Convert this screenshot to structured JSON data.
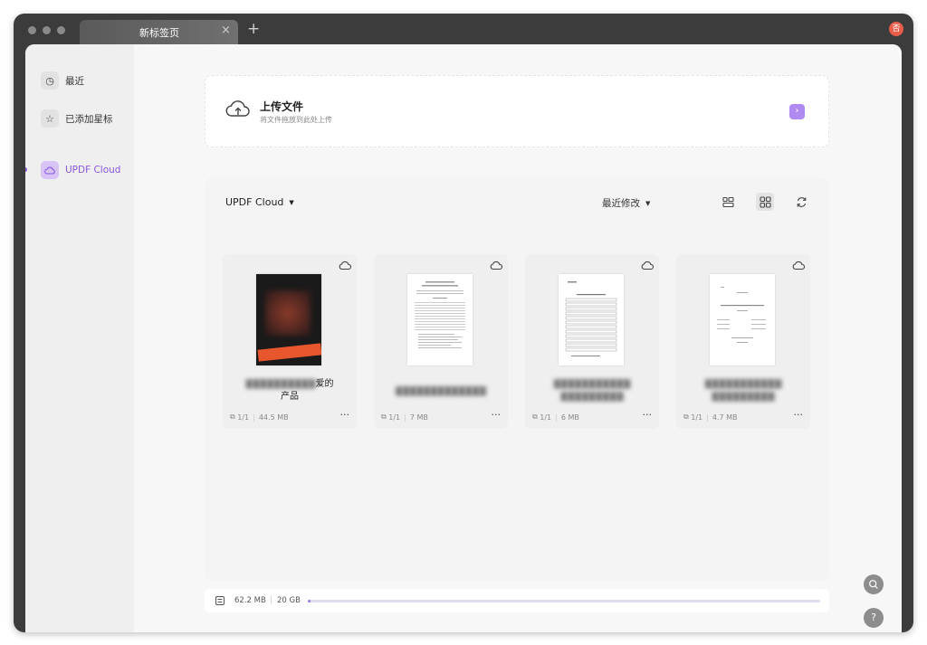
{
  "window": {
    "tab_title": "新标签页",
    "tab_close": "×",
    "new_tab": "+",
    "avatar_initial": "否"
  },
  "sidebar": {
    "items": [
      {
        "label": "最近",
        "icon": "clock-icon",
        "glyph": "◷"
      },
      {
        "label": "已添加星标",
        "icon": "star-icon",
        "glyph": "☆"
      },
      {
        "label": "UPDF Cloud",
        "icon": "cloud-icon",
        "glyph": "☁",
        "active": true
      }
    ]
  },
  "upload": {
    "title": "上传文件",
    "subtitle": "将文件拖放到此处上传",
    "button_glyph": "›"
  },
  "files": {
    "location": "UPDF Cloud",
    "sort": "最近修改",
    "caret": "▼",
    "cards": [
      {
        "name": "产品",
        "pages": "1/1",
        "size": "44.5 MB",
        "more": "···"
      },
      {
        "name": "",
        "pages": "1/1",
        "size": "7 MB",
        "more": "···"
      },
      {
        "name": "",
        "pages": "1/1",
        "size": "6 MB",
        "more": "···"
      },
      {
        "name": "",
        "pages": "1/1",
        "size": "4.7 MB",
        "more": "···"
      }
    ]
  },
  "storage": {
    "used": "62.2 MB",
    "total": "20 GB",
    "used_fraction": 0.003
  },
  "floating": {
    "search_glyph": "⌕",
    "help_glyph": "?"
  },
  "colors": {
    "accent": "#8a56e0",
    "chrome": "#3c3c3c"
  }
}
